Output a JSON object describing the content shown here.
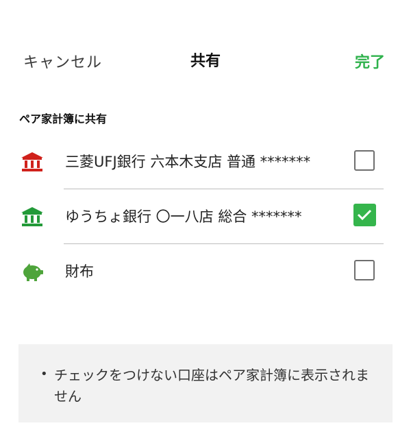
{
  "header": {
    "cancel_label": "キャンセル",
    "title": "共有",
    "done_label": "完了"
  },
  "section": {
    "label": "ペア家計簿に共有"
  },
  "accounts": [
    {
      "label": "三菱UFJ銀行 六本木支店 普通 *******",
      "icon": "bank-icon",
      "icon_color": "#d0211b",
      "checked": false
    },
    {
      "label": "ゆうちょ銀行 〇一八店 総合 *******",
      "icon": "bank-icon",
      "icon_color": "#239a39",
      "checked": true
    },
    {
      "label": "財布",
      "icon": "piggy-bank-icon",
      "icon_color": "#4ea43b",
      "checked": false
    }
  ],
  "note": {
    "bullet": "•",
    "text": "チェックをつけない口座はペア家計簿に表示されません"
  },
  "colors": {
    "accent": "#2fb24c",
    "checkbox_checked": "#35b54c"
  }
}
